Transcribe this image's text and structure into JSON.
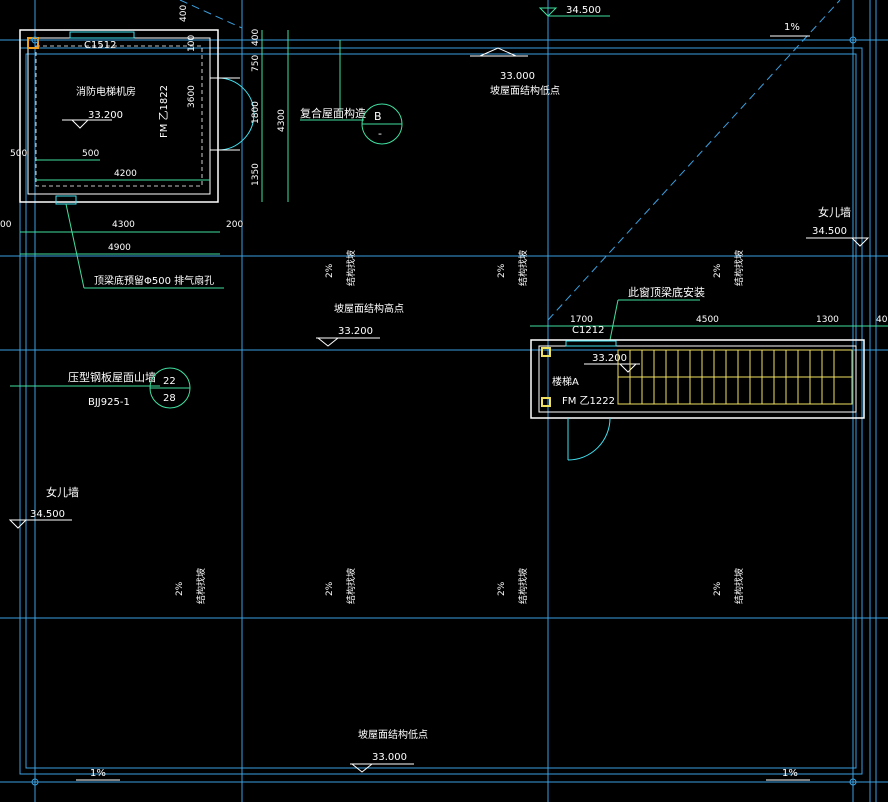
{
  "colors": {
    "background": "#000000",
    "grid": "#3aa0e0",
    "wall": "#ffffff",
    "dimension": "#40e0a0",
    "stair": "#f0e060",
    "text": "#ffffff"
  },
  "top_labels": {
    "elev_top": "34.500",
    "slope_top_right": "1%",
    "dim_400_left": "400"
  },
  "room_machine": {
    "window": "C1512",
    "name": "消防电梯机房",
    "elev": "33.200",
    "door": "FM 乙1822",
    "dim_3600": "3600",
    "dim_100": "100",
    "dim_500a": "500",
    "dim_500b": "500",
    "dim_4200": "4200",
    "dim_4300": "4300",
    "dim_4900": "4900",
    "dim_200": "200",
    "dim_00": "00"
  },
  "vertical_dims": {
    "d400": "400",
    "d750": "750",
    "d1800": "1800",
    "d1350": "1350",
    "d4300": "4300"
  },
  "callout_fuhe": {
    "label": "复合屋面构造",
    "bubble_top": "B",
    "bubble_bottom": "-"
  },
  "note_exhaust": "顶梁底预留Φ500  排气扇孔",
  "roof_points": {
    "low_top_elev": "33.000",
    "low_top_label": "坡屋面结构低点",
    "high_label": "坡屋面结构高点",
    "high_elev": "33.200",
    "low_bottom_label": "坡屋面结构低点",
    "low_bottom_elev": "33.000"
  },
  "slope_marks": {
    "pct": "2%",
    "text": "结构找坡"
  },
  "parapet_right": {
    "label": "女儿墙",
    "elev": "34.500"
  },
  "parapet_left": {
    "label": "女儿墙",
    "elev": "34.500"
  },
  "callout_gable": {
    "label": "压型钢板屋面山墙",
    "ref": "BJJ925-1",
    "bubble_top": "22",
    "bubble_bottom": "28"
  },
  "stair_room": {
    "window_note": "此窗顶梁底安装",
    "dim_1700": "1700",
    "dim_4500": "4500",
    "dim_1300": "1300",
    "dim_40": "40",
    "window": "C1212",
    "elev": "33.200",
    "name": "楼梯A",
    "door": "FM 乙1222"
  },
  "bottom_slopes": {
    "left": "1%",
    "right": "1%"
  }
}
